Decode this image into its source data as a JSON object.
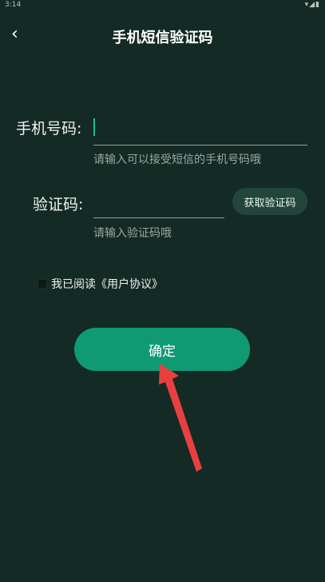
{
  "status": {
    "time": "3:14",
    "icons": "▾◢▮"
  },
  "header": {
    "back_icon": "‹",
    "title": "手机短信验证码"
  },
  "phone": {
    "label": "手机号码:",
    "value": "",
    "hint": "请输入可以接受短信的手机号码哦"
  },
  "code": {
    "label": "验证码:",
    "value": "",
    "hint": "请输入验证码哦",
    "button": "获取验证码"
  },
  "agreement": {
    "text": "我已阅读《用户协议》",
    "checked": false
  },
  "confirm": {
    "label": "确定"
  },
  "colors": {
    "background": "#142a25",
    "primary": "#0f9a74",
    "annotation_arrow": "#e8403f"
  }
}
